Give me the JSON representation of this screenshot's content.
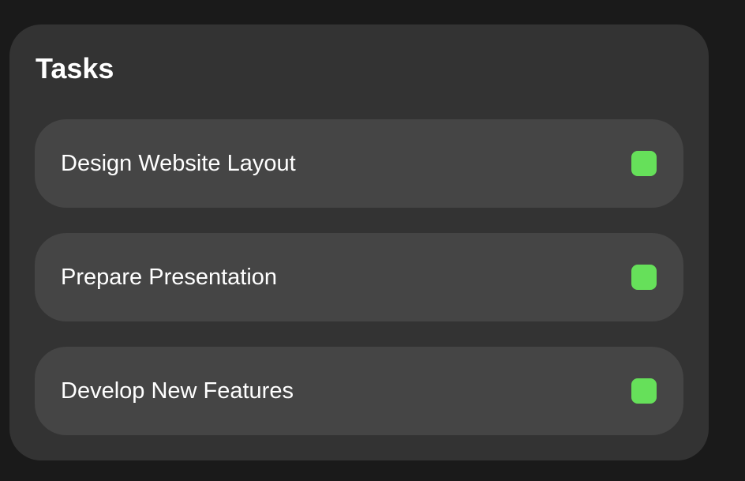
{
  "panel": {
    "title": "Tasks"
  },
  "tasks": [
    {
      "label": "Design Website Layout",
      "status_color": "#66e05a"
    },
    {
      "label": "Prepare Presentation",
      "status_color": "#66e05a"
    },
    {
      "label": "Develop New Features",
      "status_color": "#66e05a"
    }
  ]
}
